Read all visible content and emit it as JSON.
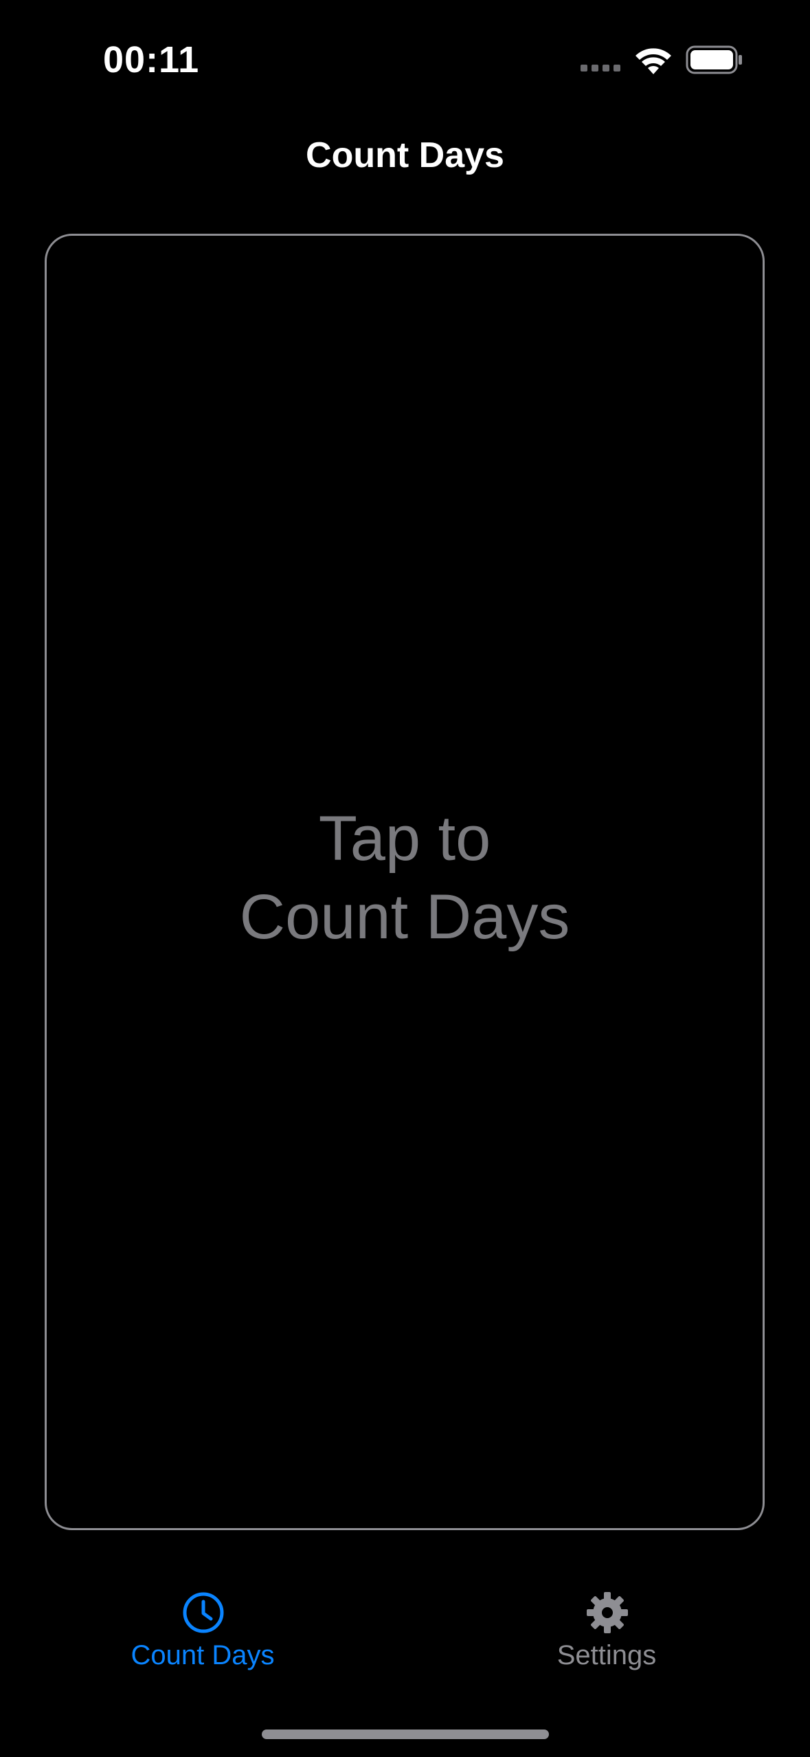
{
  "status_bar": {
    "time": "00:11"
  },
  "nav": {
    "title": "Count Days"
  },
  "card": {
    "prompt_line1": "Tap to",
    "prompt_line2": "Count Days"
  },
  "tabs": [
    {
      "label": "Count Days",
      "icon": "clock-icon",
      "selected": true
    },
    {
      "label": "Settings",
      "icon": "gear-icon",
      "selected": false
    }
  ],
  "colors": {
    "background": "#000000",
    "accent": "#0a84ff",
    "inactive": "#8e8e93",
    "prompt_text": "#7a7a7e"
  }
}
